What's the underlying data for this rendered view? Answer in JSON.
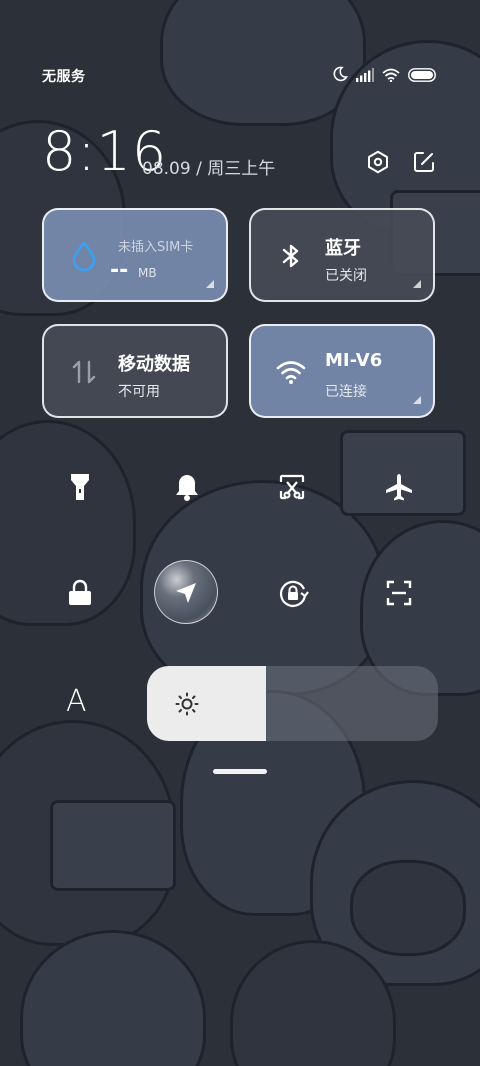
{
  "status_bar": {
    "carrier": "无服务",
    "icons": [
      "moon-icon",
      "signal-icon",
      "wifi-icon",
      "battery-icon"
    ]
  },
  "header": {
    "time": "8:16",
    "date": "08.09 / 周三上午",
    "actions": [
      "settings-icon",
      "edit-icon"
    ]
  },
  "tiles": [
    {
      "id": "data-usage",
      "title": "-- ",
      "unit": "MB",
      "subtitle": "未插入SIM卡",
      "state": "on",
      "icon": "drop-icon"
    },
    {
      "id": "bluetooth",
      "title": "蓝牙",
      "subtitle": "已关闭",
      "state": "off",
      "icon": "bluetooth-icon"
    },
    {
      "id": "mobile-data",
      "title": "移动数据",
      "subtitle": "不可用",
      "state": "off",
      "icon": "mobile-data-icon"
    },
    {
      "id": "wifi",
      "title": "MI-V6",
      "subtitle": "已连接",
      "state": "on",
      "icon": "wifi-icon"
    }
  ],
  "toggles_row1": [
    "flashlight-icon",
    "bell-icon",
    "screenshot-icon",
    "airplane-icon"
  ],
  "toggles_row2": [
    "lock-icon",
    "location-icon",
    "rotation-lock-icon",
    "scan-icon"
  ],
  "brightness": {
    "auto_label": "A",
    "level": 0.41
  },
  "colors": {
    "tile_on": "#788caf",
    "tile_off": "#464b56",
    "accent_blue": "#3aa0f0"
  }
}
